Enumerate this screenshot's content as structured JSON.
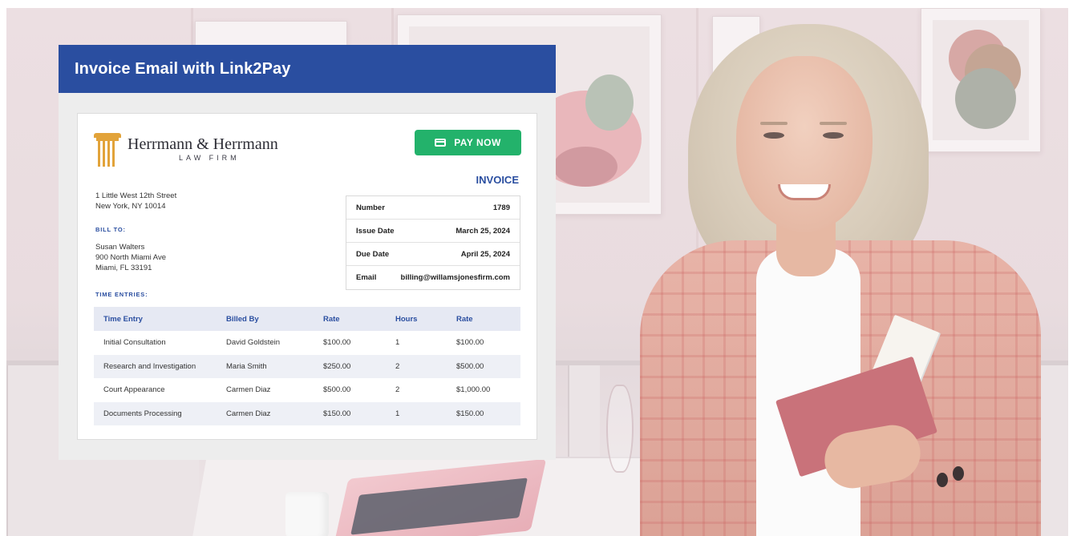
{
  "card": {
    "title": "Invoice Email with Link2Pay"
  },
  "firm": {
    "name": "Herrmann & Herrmann",
    "subtitle": "LAW FIRM",
    "address_line1": "1 Little West 12th Street",
    "address_line2": "New York, NY 10014"
  },
  "pay_button": {
    "label": "PAY NOW"
  },
  "invoice": {
    "label": "INVOICE",
    "meta": [
      {
        "key": "Number",
        "value": "1789"
      },
      {
        "key": "Issue Date",
        "value": "March 25, 2024"
      },
      {
        "key": "Due Date",
        "value": "April 25, 2024"
      },
      {
        "key": "Email",
        "value": "billing@willamsjonesfirm.com"
      }
    ]
  },
  "bill_to": {
    "label": "BILL TO:",
    "name": "Susan Walters",
    "street": "900 North Miami Ave",
    "city": "Miami, FL 33191"
  },
  "time_entries": {
    "label": "TIME ENTRIES:",
    "columns": [
      "Time Entry",
      "Billed By",
      "Rate",
      "Hours",
      "Rate"
    ],
    "rows": [
      [
        "Initial Consultation",
        "David Goldstein",
        "$100.00",
        "1",
        "$100.00"
      ],
      [
        "Research and Investigation",
        "Maria Smith",
        "$250.00",
        "2",
        "$500.00"
      ],
      [
        "Court Appearance",
        "Carmen Diaz",
        "$500.00",
        "2",
        "$1,000.00"
      ],
      [
        "Documents Processing",
        "Carmen Diaz",
        "$150.00",
        "1",
        "$150.00"
      ]
    ]
  },
  "colors": {
    "header_blue": "#2a4ea0",
    "pay_green": "#23b26b",
    "logo_gold": "#e2a33a"
  },
  "icons": [
    "pillar-logo-icon",
    "credit-card-icon"
  ]
}
